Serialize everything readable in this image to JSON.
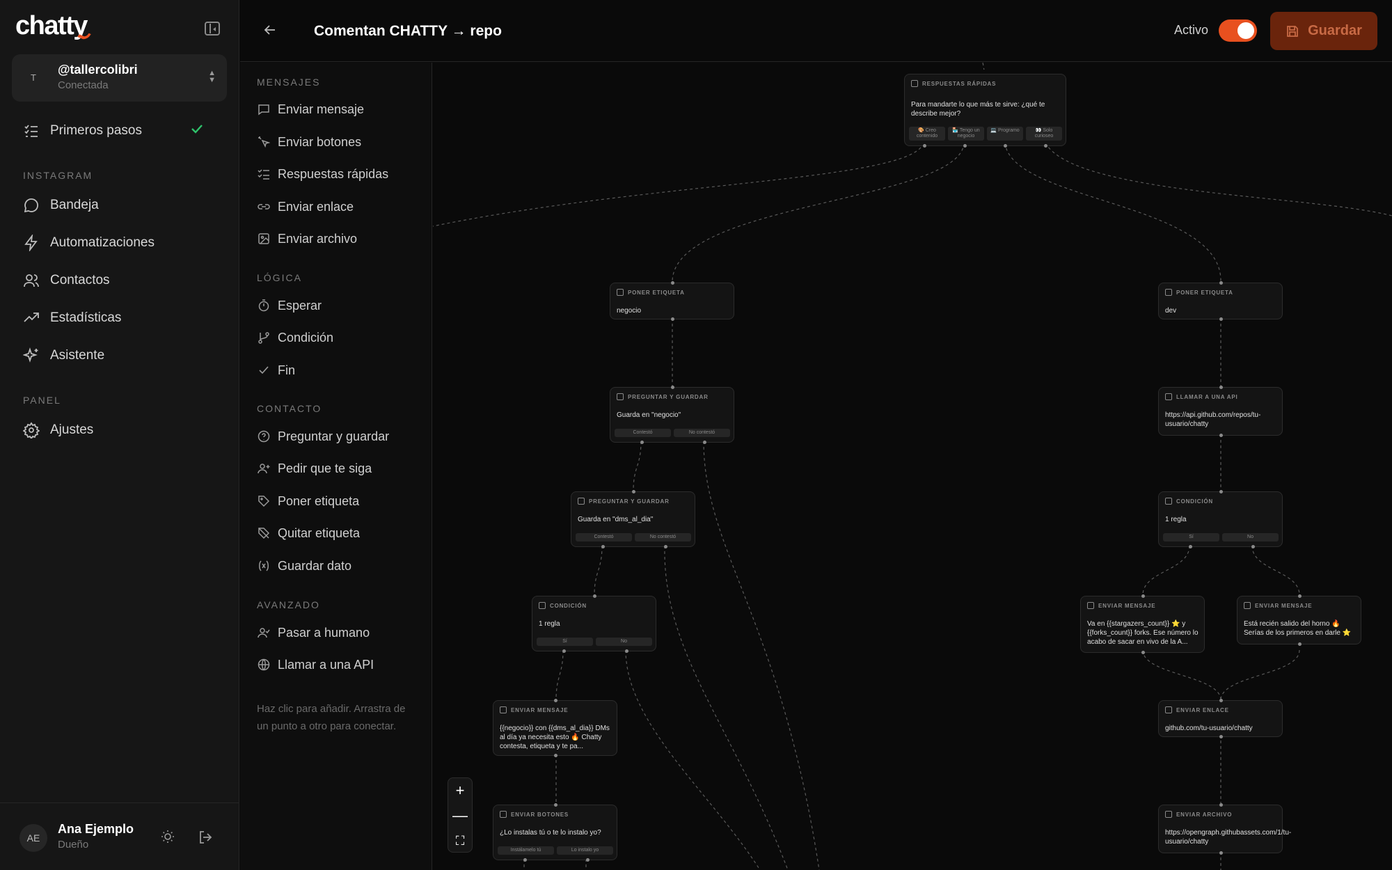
{
  "app": {
    "logo": "chatty",
    "account": {
      "avatar_letter": "T",
      "handle": "@tallercolibri",
      "status": "Conectada"
    },
    "nav": {
      "first_steps": "Primeros pasos",
      "section_instagram": "INSTAGRAM",
      "items": [
        "Bandeja",
        "Automatizaciones",
        "Contactos",
        "Estadísticas",
        "Asistente"
      ],
      "section_panel": "PANEL",
      "settings": "Ajustes"
    },
    "user": {
      "initials": "AE",
      "name": "Ana Ejemplo",
      "role": "Dueño"
    }
  },
  "header": {
    "title": "Comentan CHATTY → repo",
    "active_label": "Activo",
    "active": true,
    "save_label": "Guardar",
    "accent": "#e8501f"
  },
  "palette": {
    "sections": [
      {
        "label": "MENSAJES",
        "items": [
          "Enviar mensaje",
          "Enviar botones",
          "Respuestas rápidas",
          "Enviar enlace",
          "Enviar archivo"
        ]
      },
      {
        "label": "LÓGICA",
        "items": [
          "Esperar",
          "Condición",
          "Fin"
        ]
      },
      {
        "label": "CONTACTO",
        "items": [
          "Preguntar y guardar",
          "Pedir que te siga",
          "Poner etiqueta",
          "Quitar etiqueta",
          "Guardar dato"
        ]
      },
      {
        "label": "AVANZADO",
        "items": [
          "Pasar a humano",
          "Llamar a una API"
        ]
      }
    ],
    "hint": "Haz clic para añadir. Arrastra de un punto a otro para conectar."
  },
  "canvas": {
    "nodes": [
      {
        "id": "qr",
        "type": "RESPUESTAS RÁPIDAS",
        "body": "Para mandarte lo que más te sirve: ¿qué te describe mejor?",
        "options": [
          "🎨 Creo contenido",
          "🏪 Tengo un negocio",
          "💻 Programo",
          "👀 Solo curioseo"
        ]
      },
      {
        "id": "tag1",
        "type": "PONER ETIQUETA",
        "body": "negocio"
      },
      {
        "id": "tag2",
        "type": "PONER ETIQUETA",
        "body": "dev"
      },
      {
        "id": "ask1",
        "type": "PREGUNTAR Y GUARDAR",
        "body": "Guarda en \"negocio\"",
        "options": [
          "Contestó",
          "No contestó"
        ]
      },
      {
        "id": "api",
        "type": "LLAMAR A UNA API",
        "body": "https://api.github.com/repos/tu-usuario/chatty"
      },
      {
        "id": "ask2",
        "type": "PREGUNTAR Y GUARDAR",
        "body": "Guarda en \"dms_al_dia\"",
        "options": [
          "Contestó",
          "No contestó"
        ]
      },
      {
        "id": "cond2",
        "type": "CONDICIÓN",
        "body": "1 regla",
        "options": [
          "Sí",
          "No"
        ]
      },
      {
        "id": "cond1",
        "type": "CONDICIÓN",
        "body": "1 regla",
        "options": [
          "Sí",
          "No"
        ]
      },
      {
        "id": "msg2",
        "type": "ENVIAR MENSAJE",
        "body": "Va en {{stargazers_count}} ⭐ y {{forks_count}} forks. Ese número lo acabo de sacar en vivo de la A..."
      },
      {
        "id": "msg3",
        "type": "ENVIAR MENSAJE",
        "body": "Está recién salido del horno 🔥 Serías de los primeros en darle ⭐"
      },
      {
        "id": "msg1",
        "type": "ENVIAR MENSAJE",
        "body": "{{negocio}} con {{dms_al_dia}} DMs al día ya necesita esto 🔥 Chatty contesta, etiqueta y te pa..."
      },
      {
        "id": "link",
        "type": "ENVIAR ENLACE",
        "body": "github.com/tu-usuario/chatty"
      },
      {
        "id": "btns",
        "type": "ENVIAR BOTONES",
        "body": "¿Lo instalas tú o te lo instalo yo?",
        "options": [
          "Instálamelo tú",
          "Lo instalo yo"
        ]
      },
      {
        "id": "file",
        "type": "ENVIAR ARCHIVO",
        "body": "https://opengraph.githubassets.com/1/tu-usuario/chatty"
      }
    ],
    "zoom_controls": [
      "+",
      "—",
      "⛶"
    ]
  }
}
